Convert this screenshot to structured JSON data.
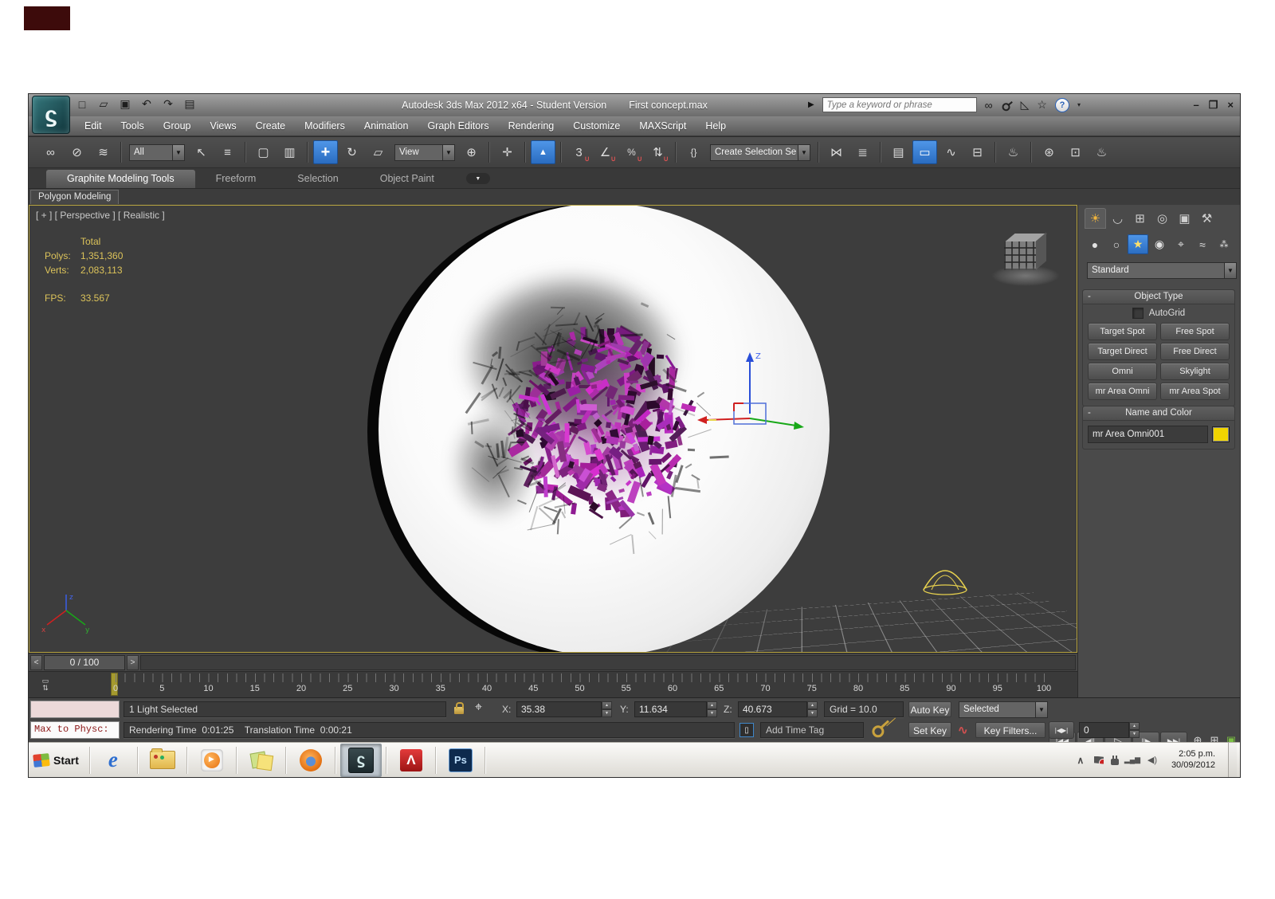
{
  "window": {
    "title_product": "Autodesk 3ds Max  2012 x64  - Student Version",
    "title_file": "First concept.max",
    "search_placeholder": "Type a keyword or phrase",
    "help_glyph": "?",
    "quick_access_icons": [
      "new-scene",
      "open-file",
      "save-file",
      "undo",
      "redo",
      "project-folder"
    ],
    "infocenter_icons": [
      "search",
      "product-key",
      "communication-center",
      "favorites"
    ],
    "window_control_glyphs": {
      "minimize": "–",
      "restore": "❐",
      "close": "×"
    }
  },
  "menu_bar": {
    "items": [
      "Edit",
      "Tools",
      "Group",
      "Views",
      "Create",
      "Modifiers",
      "Animation",
      "Graph Editors",
      "Rendering",
      "Customize",
      "MAXScript",
      "Help"
    ]
  },
  "toolbar": {
    "selection_filter_value": "All",
    "coordinate_system_value": "View",
    "named_selection_value": "Create Selection Se",
    "snap_mode": "3",
    "items": [
      "select-and-link",
      "unlink-selection",
      "bind-to-space-warp",
      "sep",
      "dd:selection_filter_value:70",
      "select-object",
      "select-by-name",
      "sep",
      "rect-selection-region",
      "window-crossing",
      "sep",
      "active:select-and-move",
      "select-and-rotate",
      "select-and-scale",
      "dd:coordinate_system_value:76",
      "use-pivot-center",
      "sep",
      "select-and-manipulate",
      "sep",
      "active:keyboard-override",
      "sep",
      "snaps-toggle",
      "angle-snap",
      "percent-snap",
      "spinner-snap",
      "sep",
      "named-selection-sets",
      "dd:named_selection_value:126",
      "sep",
      "mirror",
      "align",
      "sep",
      "manage-layers",
      "active:toggle-ribbon",
      "curve-editor",
      "schematic-view",
      "sep",
      "render-setup",
      "sep",
      "material-editor",
      "rendered-frame",
      "render-production"
    ]
  },
  "ribbon": {
    "tabs": [
      {
        "label": "Graphite Modeling Tools",
        "active": true
      },
      {
        "label": "Freeform",
        "active": false
      },
      {
        "label": "Selection",
        "active": false
      },
      {
        "label": "Object Paint",
        "active": false
      }
    ],
    "panel_label": "Polygon Modeling"
  },
  "viewport": {
    "header": "[ + ] [ Perspective ] [ Realistic ]",
    "stats": {
      "col_header": "Total",
      "polys_label": "Polys:",
      "polys_value": "1,351,360",
      "verts_label": "Verts:",
      "verts_value": "2,083,113",
      "fps_label": "FPS:",
      "fps_value": "33.567"
    },
    "gizmo_axis_label": "Z",
    "axis_labels": {
      "x": "x",
      "y": "y",
      "z": "z"
    }
  },
  "command_panel": {
    "tabs": [
      "create",
      "modify",
      "hierarchy",
      "motion",
      "display",
      "utilities"
    ],
    "active_tab": "create",
    "categories": [
      "geometry",
      "shapes",
      "lights",
      "cameras",
      "helpers",
      "space-warps",
      "systems"
    ],
    "active_category": "lights",
    "class_dropdown_value": "Standard",
    "object_type": {
      "title": "Object Type",
      "collapse_glyph": "-",
      "autogrid_label": "AutoGrid",
      "autogrid_checked": false,
      "buttons": [
        "Target Spot",
        "Free Spot",
        "Target Direct",
        "Free Direct",
        "Omni",
        "Skylight",
        "mr Area Omni",
        "mr Area Spot"
      ]
    },
    "name_and_color": {
      "title": "Name and Color",
      "collapse_glyph": "-",
      "object_name": "mr Area Omni001",
      "object_color": "#f0d400"
    }
  },
  "timeline": {
    "prev_glyph": "<",
    "next_glyph": ">",
    "frame_indicator": "0 / 100",
    "current_frame": 0,
    "tick_labels": [
      "0",
      "5",
      "10",
      "15",
      "20",
      "25",
      "30",
      "35",
      "40",
      "45",
      "50",
      "55",
      "60",
      "65",
      "70",
      "75",
      "80",
      "85",
      "90",
      "95",
      "100"
    ]
  },
  "status_bar": {
    "listener_command": "Max to Physc:",
    "selection_status": "1 Light Selected",
    "rendering_time_label": "Rendering Time",
    "rendering_time_value": "0:01:25",
    "translation_time_label": "Translation Time",
    "translation_time_value": "0:00:21",
    "x_label": "X:",
    "x_value": "35.38",
    "y_label": "Y:",
    "y_value": "11.634",
    "z_label": "Z:",
    "z_value": "40.673",
    "grid_status": "Grid = 10.0",
    "add_time_tag_label": "Add Time Tag",
    "auto_key_label": "Auto Key",
    "set_key_label": "Set Key",
    "key_filters_label": "Key Filters...",
    "selected_dropdown_value": "Selected",
    "frame_field_value": "0",
    "playback_icons": [
      "go-to-start",
      "previous-frame",
      "play",
      "next-frame",
      "go-to-end"
    ],
    "nav_icons_row1": [
      "zoom",
      "viewport-layout",
      "maximize-viewport"
    ],
    "nav_icons_row2": [
      "time-configuration",
      "pan-view",
      "orbit-view"
    ]
  },
  "taskbar": {
    "start_label": "Start",
    "apps": [
      "internet-explorer",
      "file-explorer",
      "media-player",
      "sticky-notes",
      "firefox",
      "3ds-max",
      "acrobat",
      "photoshop"
    ],
    "active_app": "3ds-max",
    "ie_glyph": "e",
    "photoshop_glyph": "Ps",
    "tray_icons": [
      "expand-tray",
      "action-center",
      "power",
      "network",
      "volume"
    ],
    "tray_time": "2:05 p.m.",
    "tray_date": "30/09/2012"
  },
  "colors": {
    "accent_blue": "#3a82d8",
    "viewport_bg": "#3d3d3d",
    "panel_bg": "#4a4a4a",
    "stats_yellow": "#dcc35a",
    "viewport_border": "#bba742",
    "purple_structure": "#8b2d8e",
    "light_color_swatch": "#f0d400"
  }
}
